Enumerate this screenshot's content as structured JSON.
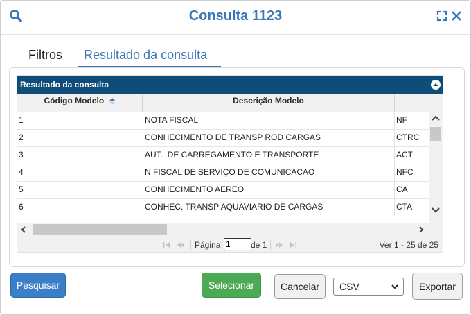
{
  "header": {
    "title": "Consulta 1123"
  },
  "tabs": [
    {
      "label": "Filtros",
      "active": false
    },
    {
      "label": "Resultado da consulta",
      "active": true
    }
  ],
  "grid": {
    "caption": "Resultado da consulta",
    "columns": [
      "Código Modelo",
      "Descrição Modelo",
      ""
    ],
    "sorted_column": "Código Modelo",
    "rows": [
      {
        "codigo": "1",
        "descricao": "NOTA FISCAL",
        "sigla": "NF"
      },
      {
        "codigo": "2",
        "descricao": "CONHECIMENTO DE TRANSP ROD CARGAS",
        "sigla": "CTRC"
      },
      {
        "codigo": "3",
        "descricao": "AUT.  DE CARREGAMENTO E TRANSPORTE",
        "sigla": "ACT"
      },
      {
        "codigo": "4",
        "descricao": "N FISCAL DE SERVIÇO DE COMUNICACAO",
        "sigla": "NFC"
      },
      {
        "codigo": "5",
        "descricao": "CONHECIMENTO AEREO",
        "sigla": "CA"
      },
      {
        "codigo": "6",
        "descricao": "CONHEC. TRANSP AQUAVIARIO DE CARGAS",
        "sigla": "CTA"
      }
    ]
  },
  "pager": {
    "page_label": "Página",
    "page_value": "1",
    "of_label": "de 1",
    "info": "Ver 1 - 25 de 25"
  },
  "buttons": {
    "pesquisar": "Pesquisar",
    "selecionar": "Selecionar",
    "cancelar": "Cancelar",
    "exportar": "Exportar"
  },
  "export_format": {
    "selected": "CSV"
  },
  "icons": {
    "search": "search-icon",
    "expand": "expand-icon",
    "close": "close-icon",
    "collapse": "collapse-icon",
    "sort": "sort-icon"
  },
  "colors": {
    "accent": "#3a78b5",
    "caption_bg": "#0f4d78",
    "primary_button": "#3a7fc8",
    "success_button": "#4caa54"
  }
}
